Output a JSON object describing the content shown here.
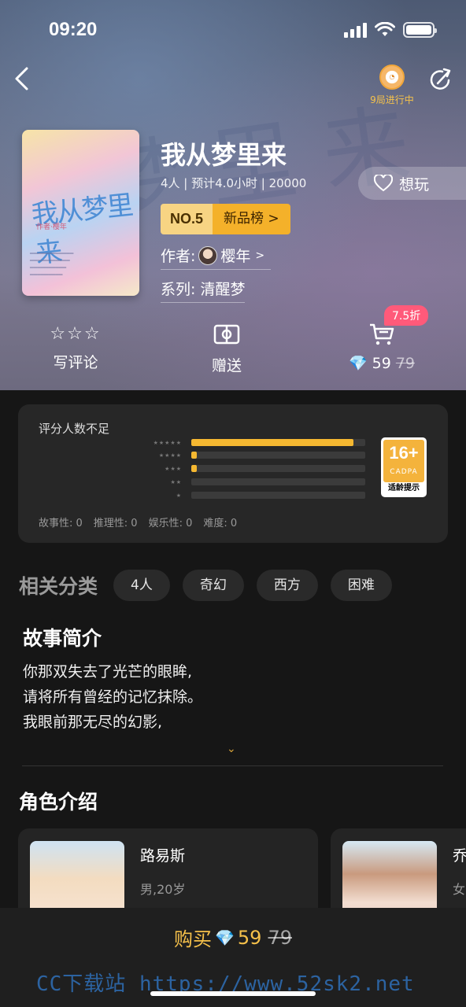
{
  "status_bar": {
    "time": "09:20"
  },
  "header": {
    "progress_text": "9局进行中"
  },
  "game": {
    "title": "我从梦里来",
    "meta": "4人 | 预计4.0小时 | 20000",
    "want_label": "想玩",
    "rank_no": "NO.5",
    "rank_list": "新品榜 >",
    "author_label": "作者:",
    "author_name": "樱年",
    "series": "系列: 清醒梦",
    "cover_title": "我从梦里来",
    "cover_sub": "作者·樱年"
  },
  "actions": {
    "review_label": "写评论",
    "gift_label": "赠送",
    "discount": "7.5折",
    "price": "59",
    "price_old": "79"
  },
  "rating": {
    "title": "评分人数不足",
    "bars": [
      {
        "stars": "★★★★★",
        "fraction": 0.93
      },
      {
        "stars": "★★★★",
        "fraction": 0.03
      },
      {
        "stars": "★★★",
        "fraction": 0.03
      },
      {
        "stars": "★★",
        "fraction": 0
      },
      {
        "stars": "★",
        "fraction": 0
      }
    ],
    "age_num": "16+",
    "age_org": "CADPA",
    "age_text": "适龄提示",
    "dimensions": [
      "故事性: 0",
      "推理性: 0",
      "娱乐性: 0",
      "难度: 0"
    ]
  },
  "categories": {
    "title": "相关分类",
    "tags": [
      "4人",
      "奇幻",
      "西方",
      "困难"
    ]
  },
  "story": {
    "title": "故事简介",
    "lines": [
      "你那双失去了光芒的眼眸,",
      "请将所有曾经的记忆抹除。",
      "我眼前那无尽的幻影,"
    ]
  },
  "characters": {
    "title": "角色介绍",
    "items": [
      {
        "name": "路易斯",
        "desc": "男,20岁"
      },
      {
        "name": "乔",
        "desc": "女"
      }
    ]
  },
  "bottom": {
    "buy_label": "购买",
    "price": "59",
    "price_old": "79",
    "watermark": "CC下载站 https://www.52sk2.net"
  }
}
